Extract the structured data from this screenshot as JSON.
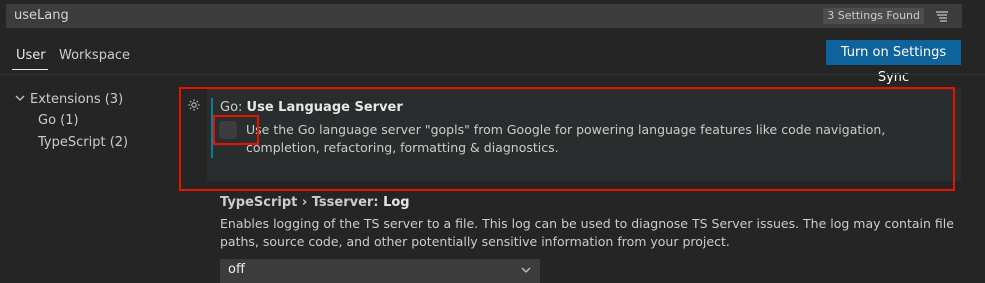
{
  "search": {
    "query": "useLang",
    "results_badge": "3 Settings Found",
    "filter_icon": "clear-filter-icon"
  },
  "tabs": [
    {
      "label": "User",
      "active": true
    },
    {
      "label": "Workspace",
      "active": false
    }
  ],
  "sync_button": {
    "label": "Turn on Settings Sync"
  },
  "tree": {
    "extensions_label": "Extensions (3)",
    "items": [
      {
        "label": "Go (1)"
      },
      {
        "label": "TypeScript (2)"
      }
    ]
  },
  "settings": [
    {
      "category": "Go: ",
      "name": "Use Language Server",
      "description": "Use the Go language server \"gopls\" from Google for powering language features like code navigation, completion, refactoring, formatting & diagnostics.",
      "checked": false
    },
    {
      "category": "TypeScript › Tsserver: ",
      "name": "Log",
      "description": "Enables logging of the TS server to a file. This log can be used to diagnose TS Server issues. The log may contain file paths, source code, and other potentially sensitive information from your project.",
      "value": "off"
    }
  ],
  "colors": {
    "accent": "#0e639c",
    "highlight": "#e51400",
    "modified_bar": "#0c7d9d"
  }
}
